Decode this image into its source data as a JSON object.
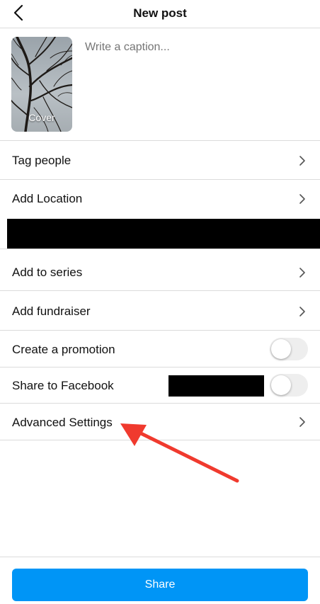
{
  "header": {
    "title": "New post",
    "back_icon": "chevron-left-icon"
  },
  "composer": {
    "caption_placeholder": "Write a caption...",
    "caption_value": "",
    "cover_label": "Cover"
  },
  "rows": {
    "tag_people": "Tag people",
    "add_location": "Add Location",
    "add_to_series": "Add to series",
    "add_fundraiser": "Add fundraiser",
    "create_promotion": "Create a promotion",
    "share_to_facebook": "Share to Facebook",
    "advanced_settings": "Advanced Settings"
  },
  "toggles": {
    "create_promotion_on": false,
    "share_to_facebook_on": false
  },
  "footer": {
    "share_label": "Share"
  },
  "colors": {
    "accent": "#0095f6",
    "divider": "#dbdbdb",
    "placeholder": "#9a9a9a",
    "toggle_off": "#eeeeee",
    "annotation_arrow": "#f03a2e",
    "redaction": "#000000"
  }
}
